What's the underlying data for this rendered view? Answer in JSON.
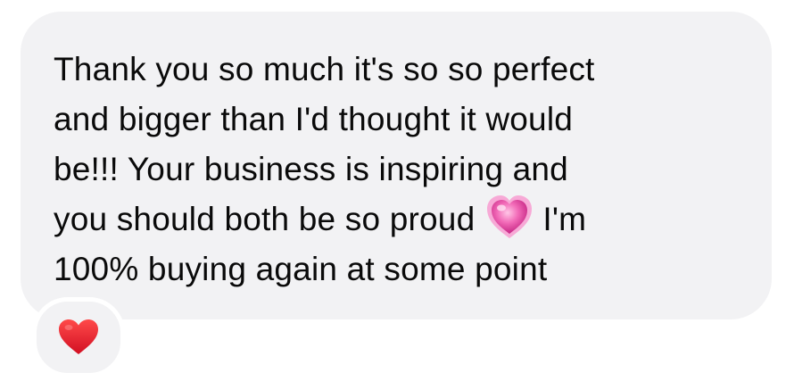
{
  "message": {
    "lines": [
      "Thank you so much it's so so perfect",
      "and bigger than I'd thought it would",
      "be!!! Your business is inspiring and",
      "you should both be so proud",
      "100% buying again at some point"
    ],
    "line4_suffix": "I'm",
    "inline_emoji": "glowing-heart",
    "bubble_color": "#f2f2f4",
    "text_color": "#0a0a0a"
  },
  "reaction": {
    "emoji": "red-heart",
    "color": "#e0162b"
  }
}
